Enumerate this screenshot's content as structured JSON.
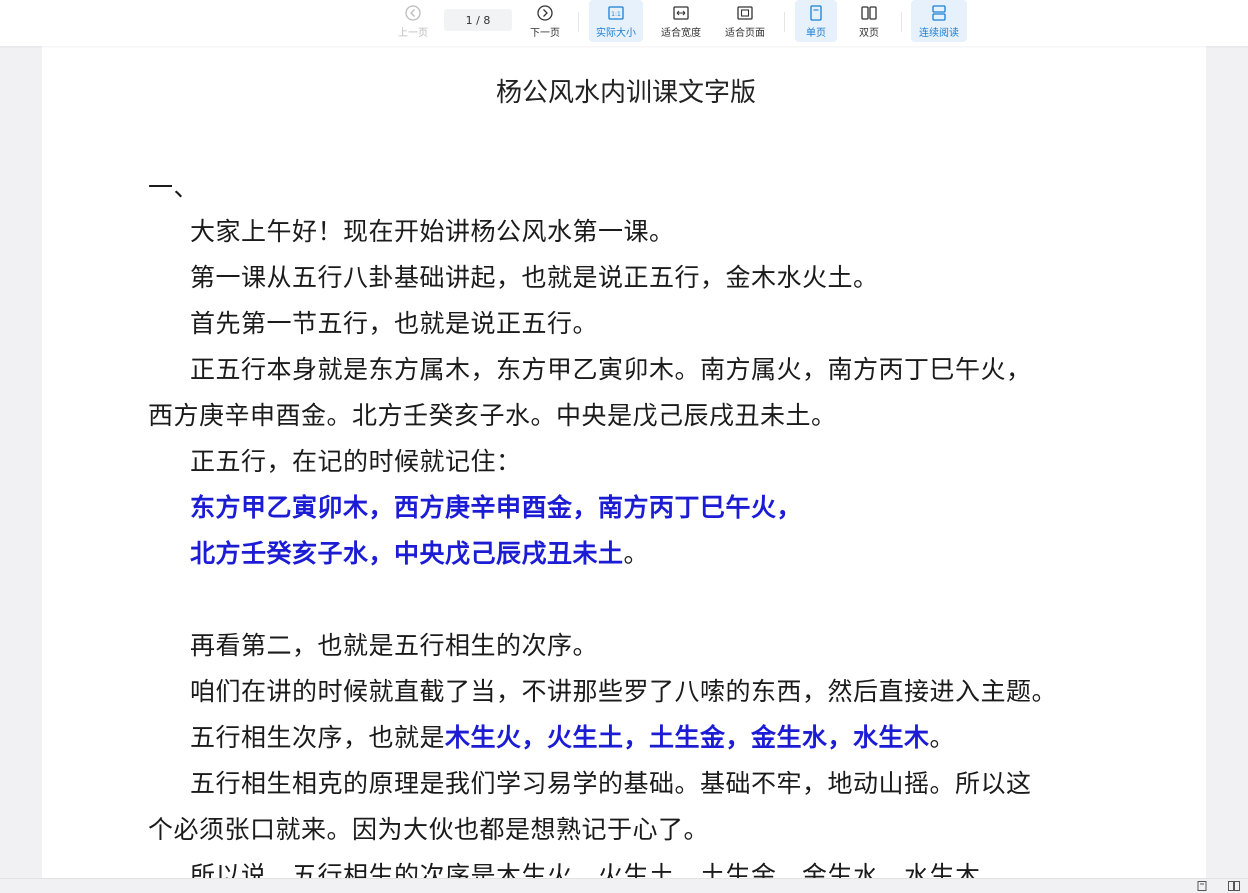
{
  "toolbar": {
    "prev_label": "上一页",
    "next_label": "下一页",
    "page_indicator": "1 / 8",
    "actual_size_label": "实际大小",
    "fit_width_label": "适合宽度",
    "fit_page_label": "适合页面",
    "single_page_label": "单页",
    "double_page_label": "双页",
    "continuous_label": "连续阅读",
    "actual_size_badge": "1:1",
    "accent_color": "#1a7fd4"
  },
  "document": {
    "title": "杨公风水内训课文字版",
    "section_number": "一、",
    "lines": [
      "大家上午好！现在开始讲杨公风水第一课。",
      "第一课从五行八卦基础讲起，也就是说正五行，金木水火土。",
      "首先第一节五行，也就是说正五行。",
      "正五行本身就是东方属木，东方甲乙寅卯木。南方属火，南方丙丁巳午火，",
      "西方庚辛申酉金。北方壬癸亥子水。中央是戊己辰戌丑未土。",
      "正五行，在记的时候就记住：",
      "东方甲乙寅卯木，西方庚辛申酉金，南方丙丁巳午火，",
      "北方壬癸亥子水，中央戊己辰戌丑未土",
      "。",
      "再看第二，也就是五行相生的次序。",
      "咱们在讲的时候就直截了当，不讲那些罗了八嗦的东西，然后直接进入主题。",
      "五行相生次序，也就是",
      "木生火，火生土，土生金，金生水，水生木",
      "。",
      "五行相生相克的原理是我们学习易学的基础。基础不牢，地动山摇。所以这",
      "个必须张口就来。因为大伙也都是想熟记于心了。",
      "所以说，五行相生的次序是木生火，火生土，土生金，金生水，水生木"
    ],
    "highlight_color": "#1c1cd4"
  }
}
